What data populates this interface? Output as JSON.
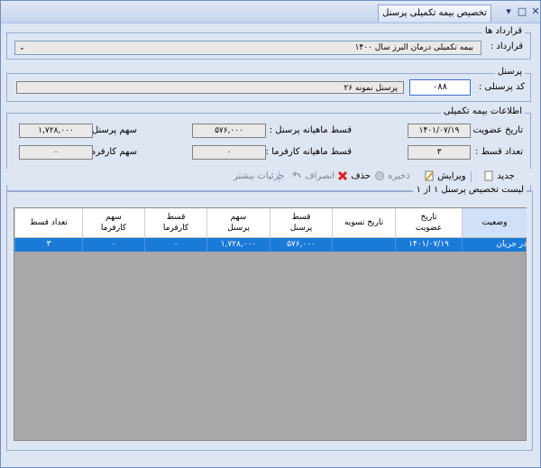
{
  "window": {
    "title": "تخصیص بیمه تکمیلی پرسنل"
  },
  "contracts": {
    "group_title": "قرارداد ها",
    "label": "قرارداد :",
    "value": "بیمه تکمیلی درمان البرز سال ۱۴۰۰"
  },
  "personnel": {
    "group_title": "پرسنل",
    "code_label": "کد پرسنلی :",
    "code_value": "۰۸۸",
    "name_value": "پرسنل  نمونه ۲۶"
  },
  "info": {
    "group_title": "اطلاعات بیمه تکمیلی",
    "membership_date_label": "تاریخ عضویت :",
    "membership_date_value": "۱۴۰۱/۰۷/۱۹",
    "monthly_personnel_label": "قسط ماهیانه پرسنل :",
    "monthly_personnel_value": "۵۷۶,۰۰۰",
    "personnel_share_label": "سهم پرسنل :",
    "personnel_share_value": "۱,۷۲۸,۰۰۰",
    "installments_label": "تعداد قسط :",
    "installments_value": "۳",
    "monthly_employer_label": "قسط ماهیانه کارفرما :",
    "monthly_employer_value": "۰",
    "employer_share_label": "سهم کارفرما :",
    "employer_share_value": "۰"
  },
  "toolbar": {
    "new": "جدید",
    "edit": "ویرایش",
    "save": "ذخیره",
    "delete": "حذف",
    "cancel": "انصراف",
    "details": "جزئیات بیشتر"
  },
  "list": {
    "title": "لیست تخصیص پرسنل ۱ از ۱",
    "columns": [
      "وضعیت",
      "تاریخ\nعضویت",
      "تاریخ تسویه",
      "قسط\nپرسنل",
      "سهم\nپرسنل",
      "قسط\nکارفرما",
      "سهم\nکارفرما",
      "تعداد قسط"
    ],
    "rows": [
      [
        "در جریان",
        "۱۴۰۱/۰۷/۱۹",
        "",
        "۵۷۶,۰۰۰",
        "۱,۷۲۸,۰۰۰",
        "۰",
        "۰",
        "۳"
      ]
    ]
  },
  "colors": {
    "selection": "#1a7ad8",
    "window_bg": "#dfe6f3"
  }
}
